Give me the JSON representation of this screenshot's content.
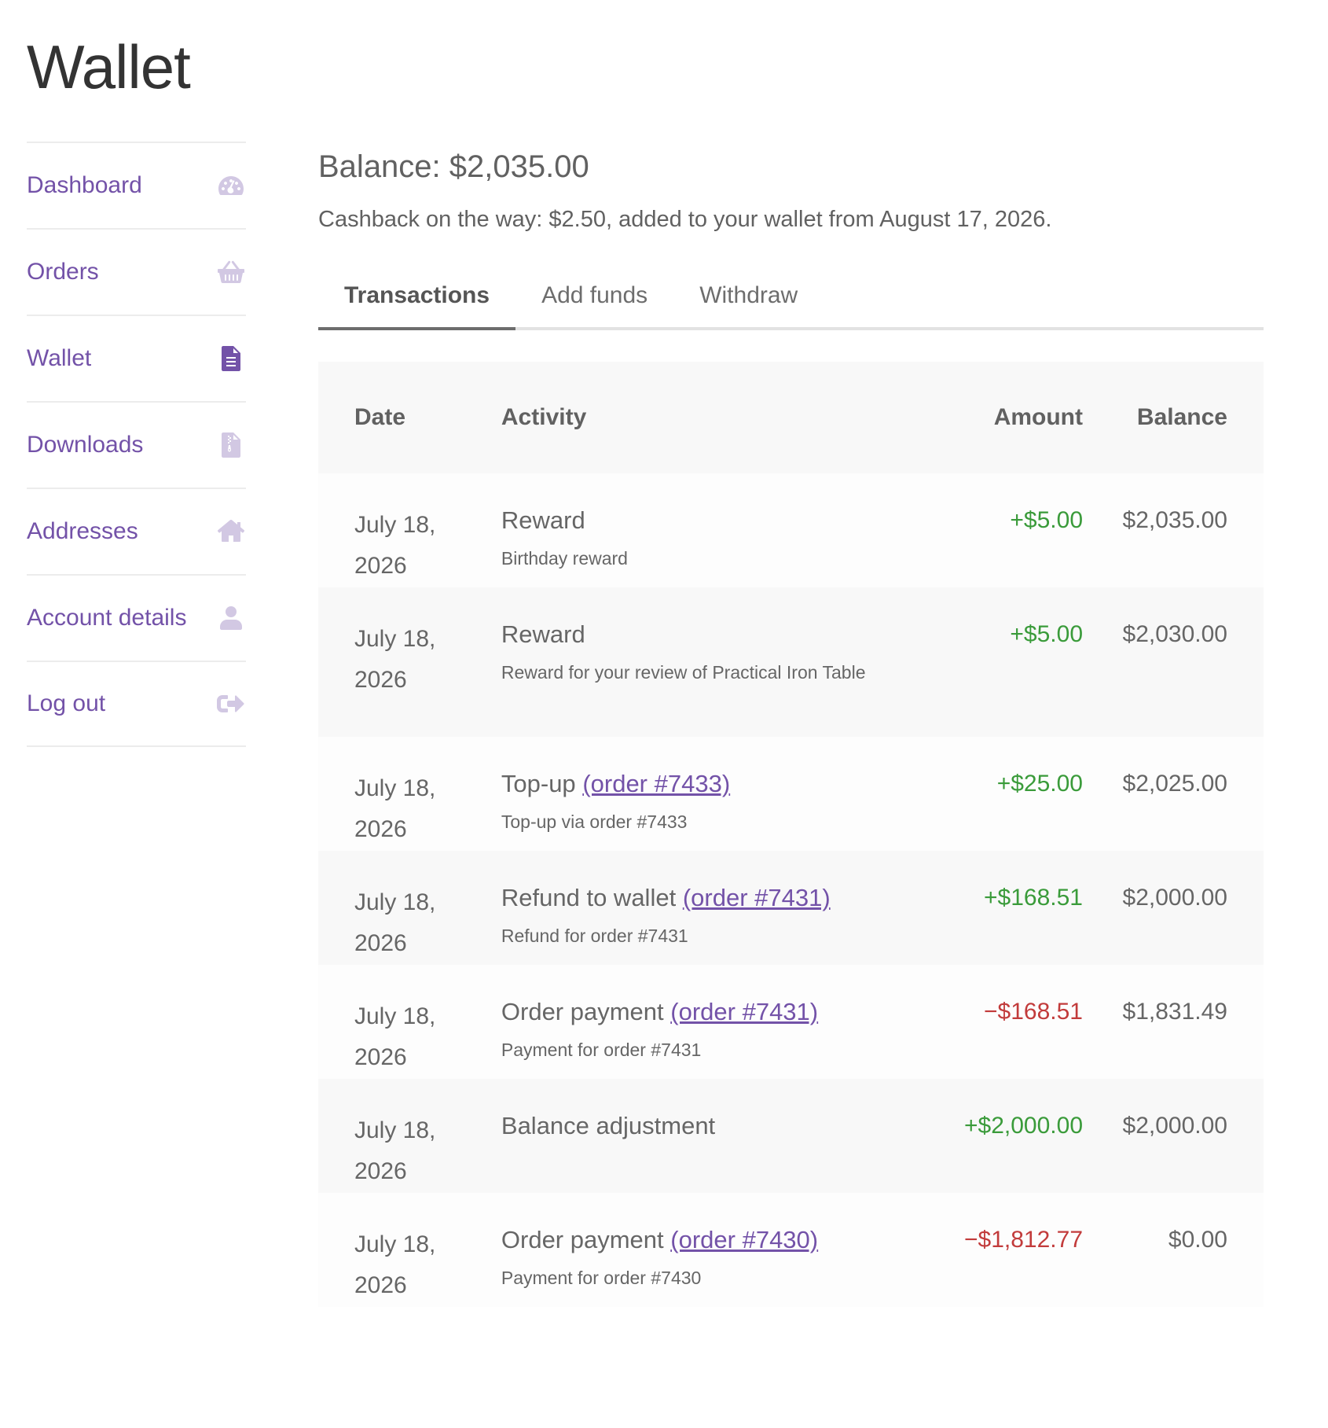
{
  "page": {
    "title": "Wallet"
  },
  "sidebar": {
    "items": [
      {
        "label": "Dashboard",
        "icon": "dashboard-gauge-icon",
        "active": false
      },
      {
        "label": "Orders",
        "icon": "basket-icon",
        "active": false
      },
      {
        "label": "Wallet",
        "icon": "document-icon",
        "active": true
      },
      {
        "label": "Downloads",
        "icon": "file-archive-icon",
        "active": false
      },
      {
        "label": "Addresses",
        "icon": "home-icon",
        "active": false
      },
      {
        "label": "Account details",
        "icon": "user-icon",
        "active": false
      },
      {
        "label": "Log out",
        "icon": "sign-out-icon",
        "active": false
      }
    ]
  },
  "wallet": {
    "balance": "Balance: $2,035.00",
    "cashback": "Cashback on the way: $2.50, added to your wallet from August 17, 2026."
  },
  "tabs": [
    "Transactions",
    "Add funds",
    "Withdraw"
  ],
  "table": {
    "headers": {
      "date": "Date",
      "activity": "Activity",
      "amount": "Amount",
      "balance": "Balance"
    },
    "rows": [
      {
        "date": "July 18, 2026",
        "activity": "Reward",
        "link": "",
        "detail": "Birthday reward",
        "amount": "+$5.00",
        "type": "pos",
        "balance": "$2,035.00"
      },
      {
        "date": "July 18, 2026",
        "activity": "Reward",
        "link": "",
        "detail": "Reward for your review of Practical Iron Table",
        "amount": "+$5.00",
        "type": "pos",
        "balance": "$2,030.00"
      },
      {
        "date": "July 18, 2026",
        "activity": "Top-up",
        "link": "(order #7433)",
        "detail": "Top-up via order #7433",
        "amount": "+$25.00",
        "type": "pos",
        "balance": "$2,025.00"
      },
      {
        "date": "July 18, 2026",
        "activity": "Refund to wallet",
        "link": "(order #7431)",
        "detail": "Refund for order #7431",
        "amount": "+$168.51",
        "type": "pos",
        "balance": "$2,000.00"
      },
      {
        "date": "July 18, 2026",
        "activity": "Order payment",
        "link": "(order #7431)",
        "detail": "Payment for order #7431",
        "amount": "−$168.51",
        "type": "neg",
        "balance": "$1,831.49"
      },
      {
        "date": "July 18, 2026",
        "activity": "Balance adjustment",
        "link": "",
        "detail": "",
        "amount": "+$2,000.00",
        "type": "pos",
        "balance": "$2,000.00"
      },
      {
        "date": "July 18, 2026",
        "activity": "Order payment",
        "link": "(order #7430)",
        "detail": "Payment for order #7430",
        "amount": "−$1,812.77",
        "type": "neg",
        "balance": "$0.00"
      }
    ]
  },
  "colors": {
    "accent": "#7352a8",
    "positive": "#3a9b3a",
    "negative": "#c23b3b",
    "icon_muted": "#d2c8e3"
  }
}
